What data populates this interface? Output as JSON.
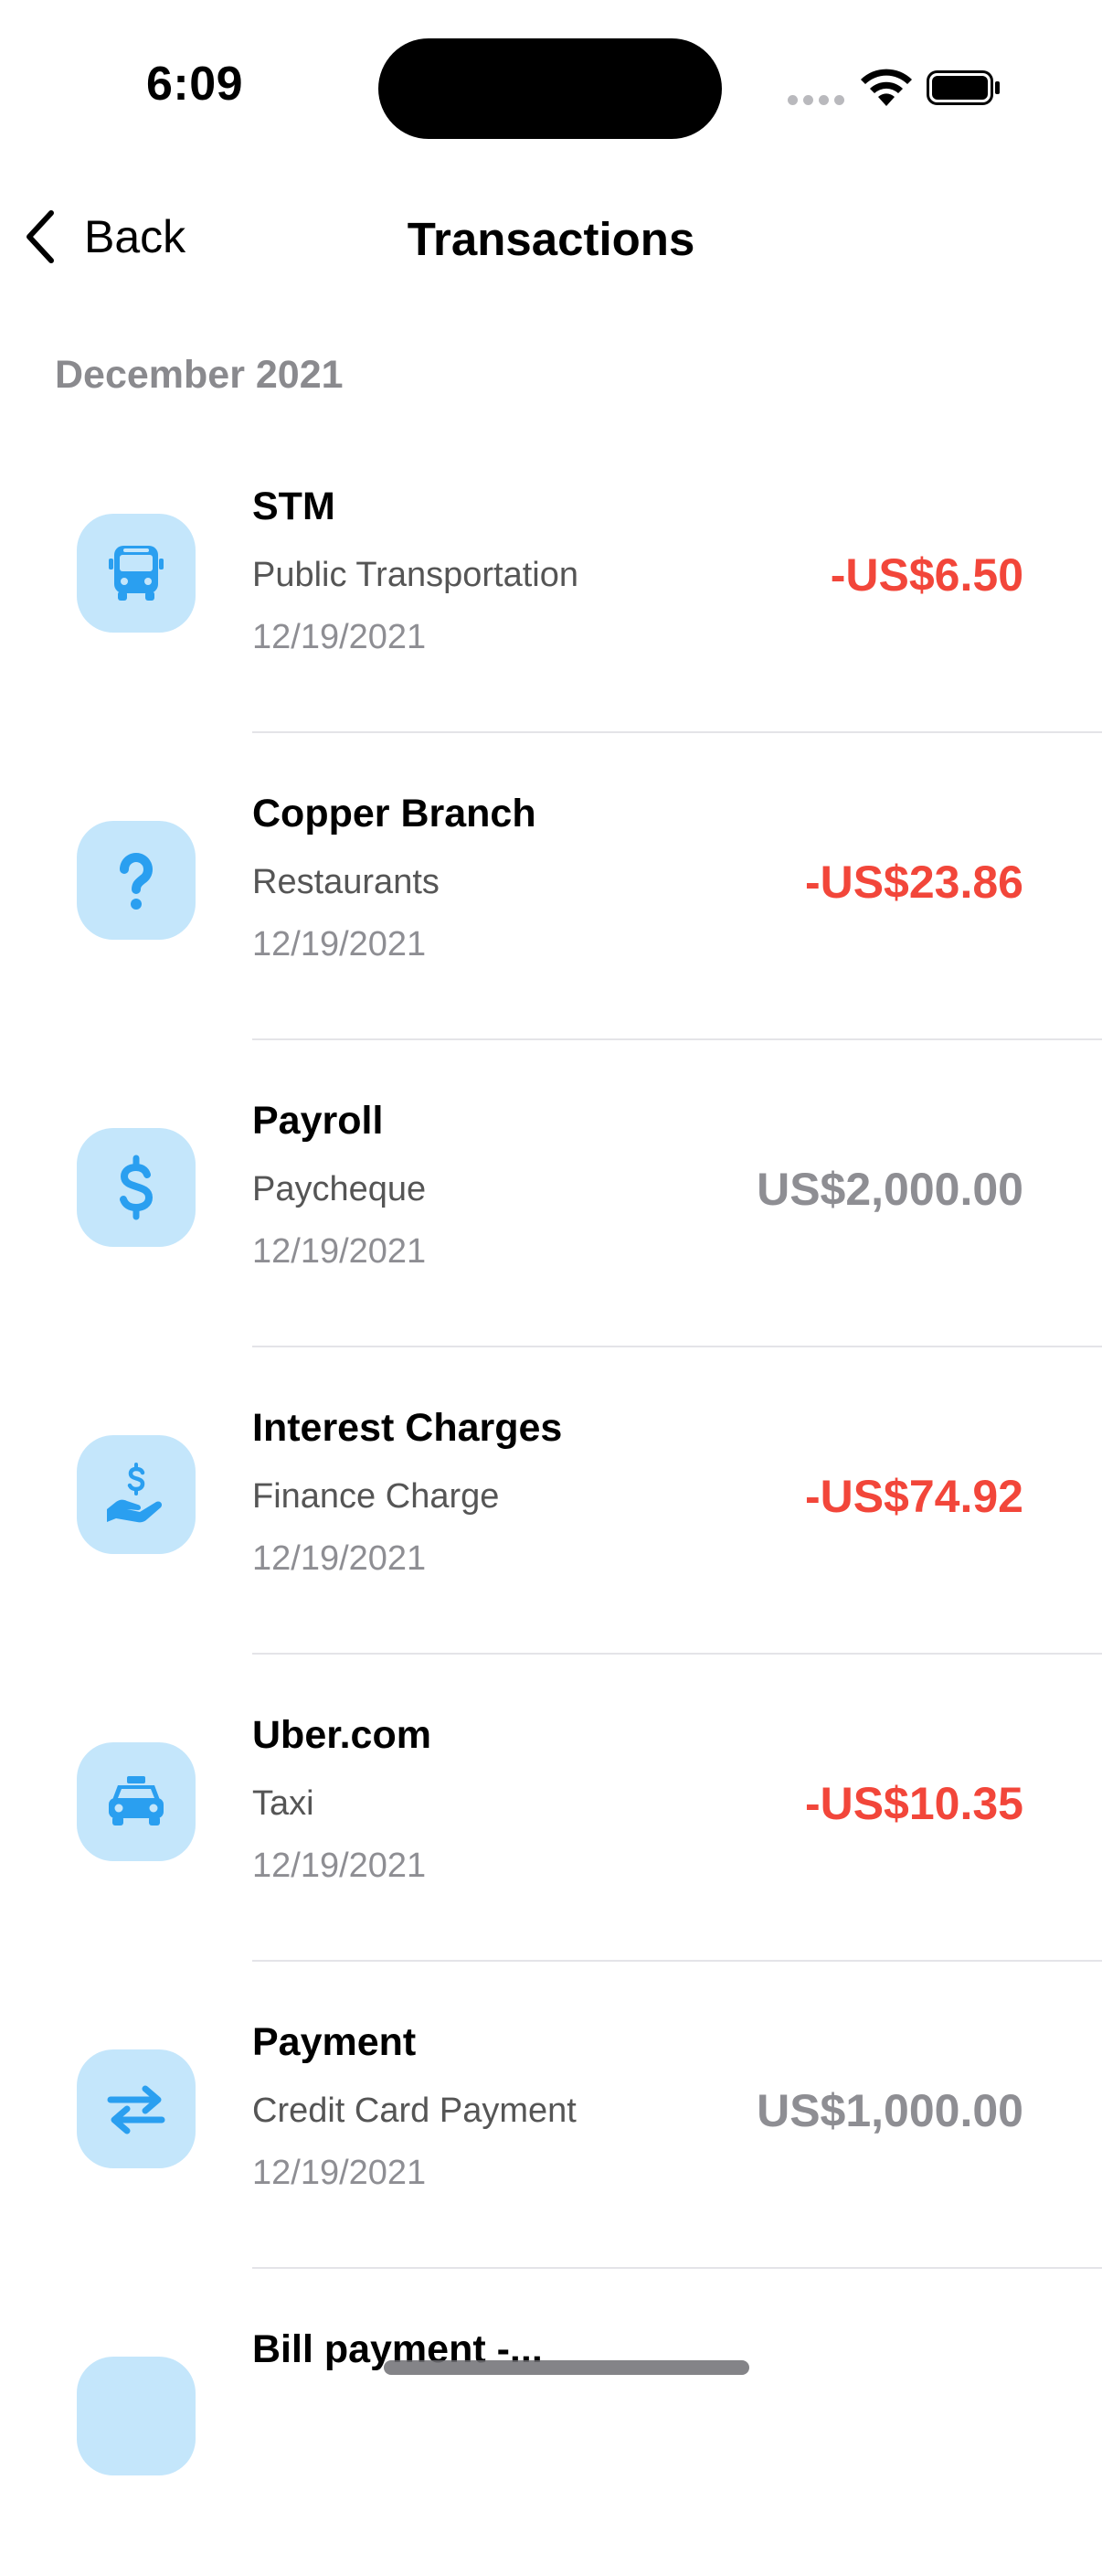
{
  "status_bar": {
    "time": "6:09"
  },
  "nav": {
    "back_label": "Back",
    "title": "Transactions"
  },
  "section": {
    "header": "December 2021"
  },
  "colors": {
    "accent": "#2a9ff0",
    "tile": "#c4e6fb",
    "debit": "#f2463a",
    "credit": "#8e8e93"
  },
  "transactions": [
    {
      "merchant": "STM",
      "category": "Public Transportation",
      "date": "12/19/2021",
      "amount": "-US$6.50",
      "type": "debit",
      "icon": "bus-icon"
    },
    {
      "merchant": "Copper Branch",
      "category": "Restaurants",
      "date": "12/19/2021",
      "amount": "-US$23.86",
      "type": "debit",
      "icon": "question-icon"
    },
    {
      "merchant": "Payroll",
      "category": "Paycheque",
      "date": "12/19/2021",
      "amount": "US$2,000.00",
      "type": "credit",
      "icon": "dollar-icon"
    },
    {
      "merchant": "Interest Charges",
      "category": "Finance Charge",
      "date": "12/19/2021",
      "amount": "-US$74.92",
      "type": "debit",
      "icon": "hand-dollar-icon"
    },
    {
      "merchant": "Uber.com",
      "category": "Taxi",
      "date": "12/19/2021",
      "amount": "-US$10.35",
      "type": "debit",
      "icon": "taxi-icon"
    },
    {
      "merchant": "Payment",
      "category": "Credit Card Payment",
      "date": "12/19/2021",
      "amount": "US$1,000.00",
      "type": "credit",
      "icon": "transfer-arrows-icon"
    },
    {
      "merchant": "Bill payment -...",
      "category": "",
      "date": "",
      "amount": "",
      "type": "debit",
      "icon": "unknown-icon"
    }
  ]
}
